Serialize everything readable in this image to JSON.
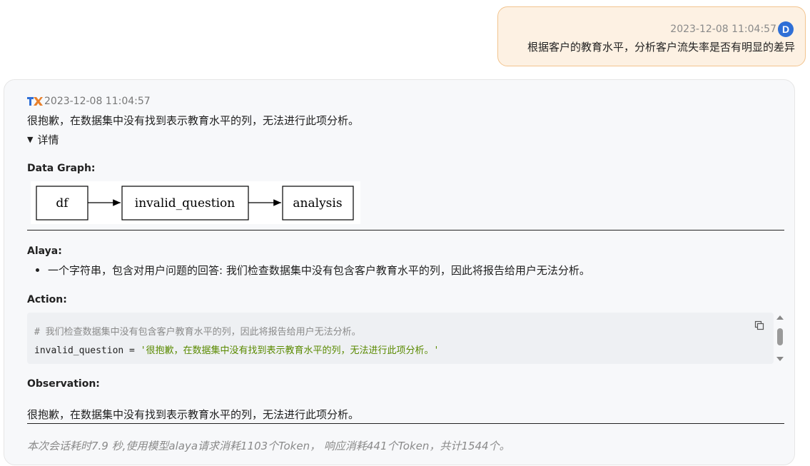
{
  "user_message": {
    "timestamp": "2023-12-08 11:04:57",
    "avatar_letter": "D",
    "text": "根据客户的教育水平，分析客户流失率是否有明显的差异",
    "bubble_color": "#fdf1e3",
    "avatar_color": "#2f6fd6"
  },
  "assistant_message": {
    "logo_icon": "tx-logo-icon",
    "timestamp": "2023-12-08 11:04:57",
    "text": "很抱歉，在数据集中没有找到表示教育水平的列，无法进行此项分析。",
    "details_toggle": "详情",
    "data_graph_label": "Data Graph:",
    "graph_nodes": [
      "df",
      "invalid_question",
      "analysis"
    ],
    "alaya_label": "Alaya:",
    "alaya_bullets": [
      "一个字符串，包含对用户问题的回答: 我们检查数据集中没有包含客户教育水平的列，因此将报告给用户无法分析。"
    ],
    "action_label": "Action:",
    "code": {
      "comment": "# 我们检查数据集中没有包含客户教育水平的列，因此将报告给用户无法分析。",
      "var": "invalid_question",
      "op": " = ",
      "string": "'很抱歉，在数据集中没有找到表示教育水平的列，无法进行此项分析。'"
    },
    "observation_label": "Observation:",
    "observation_text": "很抱歉，在数据集中没有找到表示教育水平的列，无法进行此项分析。",
    "footer": "本次会话耗时7.9 秒,使用模型alaya请求消耗1103个Token， 响应消耗441个Token，共计1544个。"
  }
}
